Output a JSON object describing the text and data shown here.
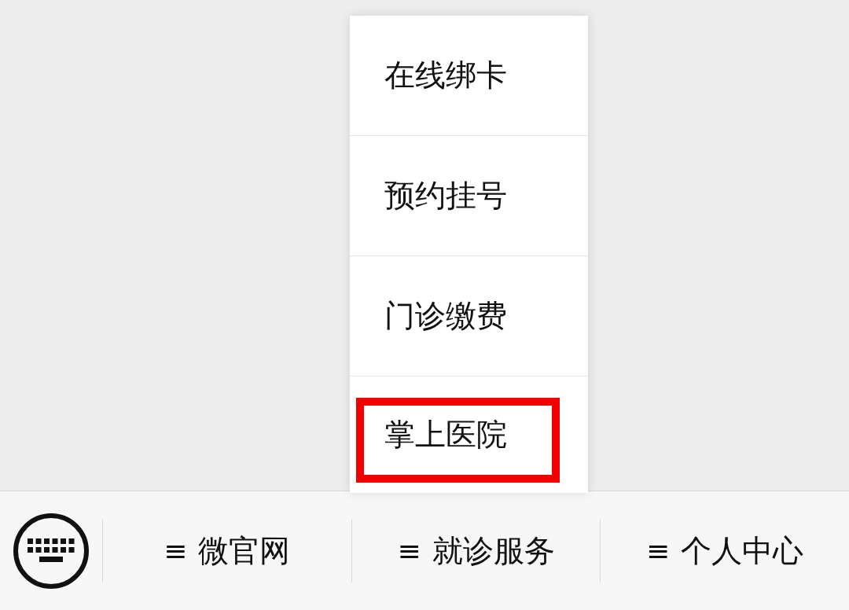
{
  "submenu": {
    "items": [
      {
        "label": "在线绑卡",
        "highlighted": false
      },
      {
        "label": "预约挂号",
        "highlighted": false
      },
      {
        "label": "门诊缴费",
        "highlighted": false
      },
      {
        "label": "掌上医院",
        "highlighted": true
      }
    ]
  },
  "menu_bar": {
    "buttons": [
      {
        "icon": "≡",
        "label": "微官网",
        "selected": false
      },
      {
        "icon": "≡",
        "label": "就诊服务",
        "selected": true
      },
      {
        "icon": "≡",
        "label": "个人中心",
        "selected": false
      }
    ]
  }
}
